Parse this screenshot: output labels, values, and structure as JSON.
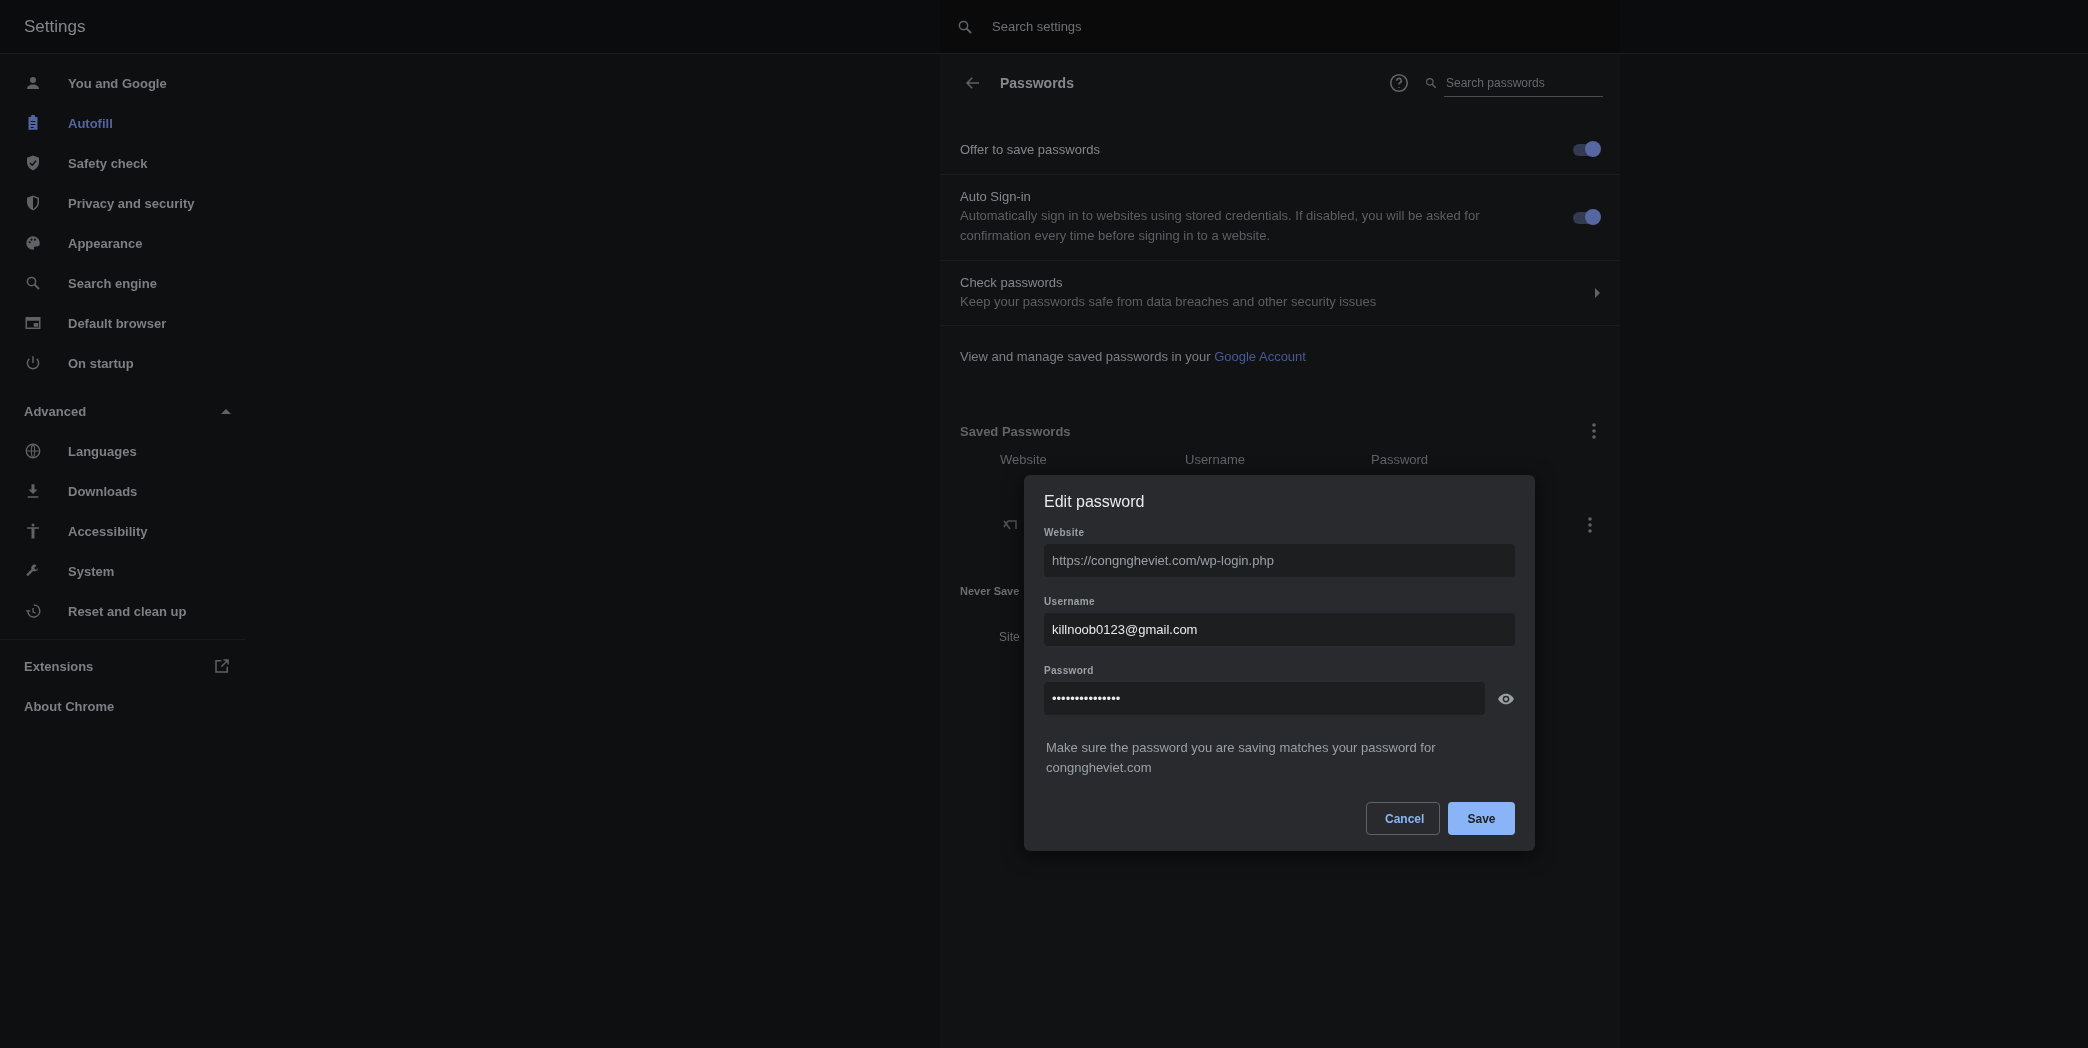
{
  "header": {
    "title": "Settings",
    "search": {
      "placeholder": "Search settings"
    }
  },
  "sidebar": {
    "items": [
      {
        "label": "You and Google",
        "selected": false
      },
      {
        "label": "Autofill",
        "selected": true
      },
      {
        "label": "Safety check",
        "selected": false
      },
      {
        "label": "Privacy and security",
        "selected": false
      },
      {
        "label": "Appearance",
        "selected": false
      },
      {
        "label": "Search engine",
        "selected": false
      },
      {
        "label": "Default browser",
        "selected": false
      },
      {
        "label": "On startup",
        "selected": false
      }
    ],
    "advanced": {
      "label": "Advanced",
      "expanded": true,
      "items": [
        {
          "label": "Languages",
          "selected": false
        },
        {
          "label": "Downloads",
          "selected": false
        },
        {
          "label": "Accessibility",
          "selected": false
        },
        {
          "label": "System",
          "selected": false
        },
        {
          "label": "Reset and clean up",
          "selected": false
        }
      ]
    },
    "footer": [
      {
        "label": "Extensions",
        "external": true
      },
      {
        "label": "About Chrome",
        "external": false
      }
    ]
  },
  "passwords_page": {
    "title": "Passwords",
    "search": {
      "placeholder": "Search passwords"
    },
    "settings": [
      {
        "kind": "toggle",
        "title": "Offer to save passwords",
        "on": true
      },
      {
        "kind": "toggle",
        "title": "Auto Sign-in",
        "description": "Automatically sign in to websites using stored credentials. If disabled, you will be asked for confirmation every time before signing in to a website.",
        "on": true
      },
      {
        "kind": "link",
        "title": "Check passwords",
        "description": "Keep your passwords safe from data breaches and other security issues"
      }
    ],
    "account_note": {
      "text": "View and manage saved passwords in your",
      "link": "Google Account"
    },
    "saved_passwords": {
      "title": "Saved Passwords",
      "columns": [
        "Website",
        "Username",
        "Password"
      ]
    },
    "never_saved": {
      "title": "Never Save",
      "columns": [
        "Site"
      ]
    }
  },
  "dialog": {
    "title": "Edit password",
    "fields": [
      {
        "label": "Website",
        "value": "https://congngheviet.com/wp-login.php",
        "disabled": true
      },
      {
        "label": "Username",
        "value": "killnoob0123@gmail.com",
        "disabled": false
      },
      {
        "label": "Password",
        "value": "•••••••••••••••",
        "disabled": false,
        "reveal": true
      }
    ],
    "note": "Make sure the password you are saving matches your password for congngheviet.com",
    "buttons": [
      {
        "label": "Cancel",
        "kind": "outline"
      },
      {
        "label": "Save",
        "kind": "primary"
      }
    ]
  }
}
